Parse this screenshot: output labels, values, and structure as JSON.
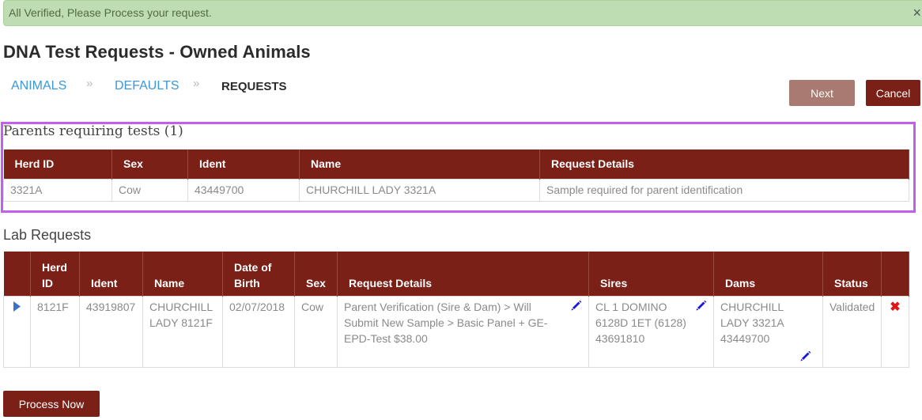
{
  "alert": {
    "message": "All Verified, Please Process your request.",
    "close": "×"
  },
  "page": {
    "title": "DNA Test Requests - Owned Animals"
  },
  "steps": [
    {
      "label": "ANIMALS"
    },
    {
      "label": "DEFAULTS"
    },
    {
      "label": "REQUESTS"
    }
  ],
  "step_separator": "»",
  "buttons": {
    "next": "Next",
    "cancel": "Cancel",
    "process_now": "Process Now"
  },
  "parents_section": {
    "title": "Parents requiring tests (1)",
    "columns": [
      "Herd ID",
      "Sex",
      "Ident",
      "Name",
      "Request Details"
    ],
    "rows": [
      {
        "herd_id": "3321A",
        "sex": "Cow",
        "ident": "43449700",
        "name": "CHURCHILL LADY 3321A",
        "details": "Sample required for parent identification"
      }
    ]
  },
  "lab_section": {
    "title": "Lab Requests",
    "columns": [
      "Herd ID",
      "Ident",
      "Name",
      "Date of Birth",
      "Sex",
      "Request Details",
      "Sires",
      "Dams",
      "Status"
    ],
    "rows": [
      {
        "herd_id": "8121F",
        "ident": "43919807",
        "name": "CHURCHILL LADY 8121F",
        "dob": "02/07/2018",
        "sex": "Cow",
        "details": "Parent Verification (Sire & Dam) > Will Submit New Sample > Basic Panel + GE-EPD-Test $38.00",
        "sire": "CL 1 DOMINO 6128D 1ET (6128) 43691810",
        "dam": "CHURCHILL LADY 3321A 43449700",
        "status": "Validated",
        "delete": "✖"
      }
    ]
  },
  "colors": {
    "header_bg": "#7b2016",
    "alert_bg": "#bfddb2",
    "link": "#3b97d8",
    "next_btn": "#a97a72",
    "highlight": "#c45ef0",
    "delete": "#e01515",
    "edit_icon": "#1a1adb"
  },
  "icons": {
    "expand": "triangle-right-icon",
    "edit": "pencil-icon",
    "delete": "x-delete-icon",
    "close": "close-icon"
  }
}
